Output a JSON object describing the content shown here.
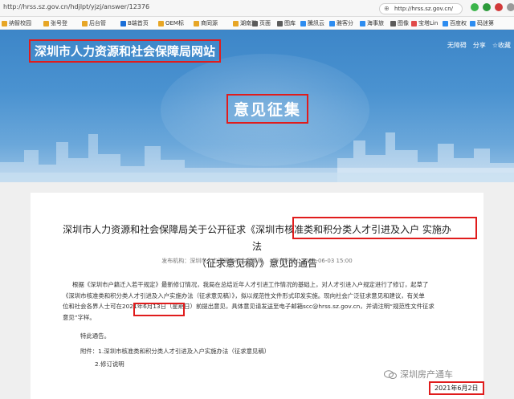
{
  "browser": {
    "url": "http://hrss.sz.gov.cn/hdjlpt/yjzj/answer/12376",
    "second_url": "http://hrss.sz.gov.cn/"
  },
  "bookmarks": [
    "纳智校园",
    "张号登",
    "后台管",
    "B端首页",
    "OEM标",
    "商同源",
    "湖南游",
    "",
    "页面",
    "图库",
    "騰訊云",
    "雅客分",
    "海事旅",
    "图像",
    "宝塔Lin",
    "百度权",
    "码迷第",
    "SEO优",
    "摩天"
  ],
  "header": {
    "site_title": "深圳市人力资源和社会保障局网站",
    "links": [
      "无障碍",
      "分享",
      "收藏"
    ],
    "page_title": "意见征集"
  },
  "article": {
    "title_line1": "深圳市人力资源和社会保障局关于公开征求《深圳市核准类和积分类人才引进及入户 实施办法",
    "title_line2": "（征求意见稿）》意见的通告",
    "publisher": "发布机构：深圳市人力资源和社会保障局",
    "publish_time": "发布时间：2021-06-03 15:00",
    "paragraph_lines": [
      "根据《深圳市户籍迁入若干规定》最新修订情况，我局在总结近年人才引进工作情况的基础上，对人才引进入户规定进行了修订，起草了",
      "《深圳市核准类和积分类人才引进及入户实施办法（征求意见稿）》，拟以规范性文件形式印发实施。现向社会广泛征求意见和建议，有关单",
      "位和社会各界人士可在2021年6月13日（星期日）前提出意见，具体意见请发送至电子邮箱scc@hrss.sz.gov.cn，并请注明“规范性文件征求",
      "意见”字样。"
    ],
    "notice": "特此通告。",
    "attachment1": "附件：1.深圳市核准类和积分类人才引进及入户实施办法（征求意见稿）",
    "attachment2": "2.修订说明",
    "date": "2021年6月2日"
  },
  "watermark": "深圳房产通车",
  "colors": {
    "highlight": "#e01c1c",
    "banner": "#4a92d0"
  }
}
